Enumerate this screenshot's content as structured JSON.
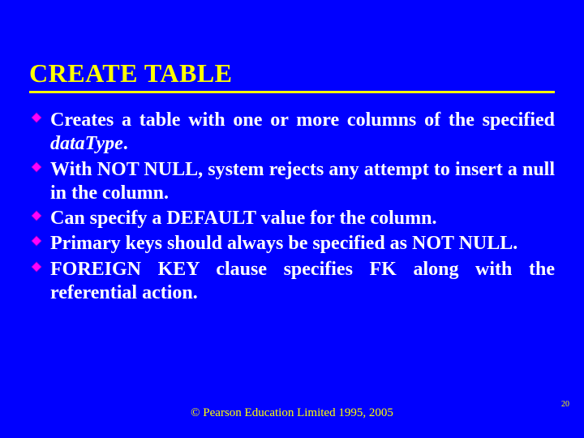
{
  "title": "CREATE TABLE",
  "bullets": [
    {
      "pre": "Creates a table with one or more columns of the specified ",
      "italic": "dataType",
      "post": "."
    },
    {
      "pre": "With NOT NULL, system rejects any attempt to insert a null in the column.",
      "italic": "",
      "post": ""
    },
    {
      "pre": "Can specify a DEFAULT value for the column.",
      "italic": "",
      "post": ""
    },
    {
      "pre": "Primary keys should always be specified as NOT NULL.",
      "italic": "",
      "post": ""
    },
    {
      "pre": "FOREIGN KEY clause specifies FK along with the referential action.",
      "italic": "",
      "post": ""
    }
  ],
  "footer": "© Pearson Education Limited 1995, 2005",
  "page_number": "20"
}
